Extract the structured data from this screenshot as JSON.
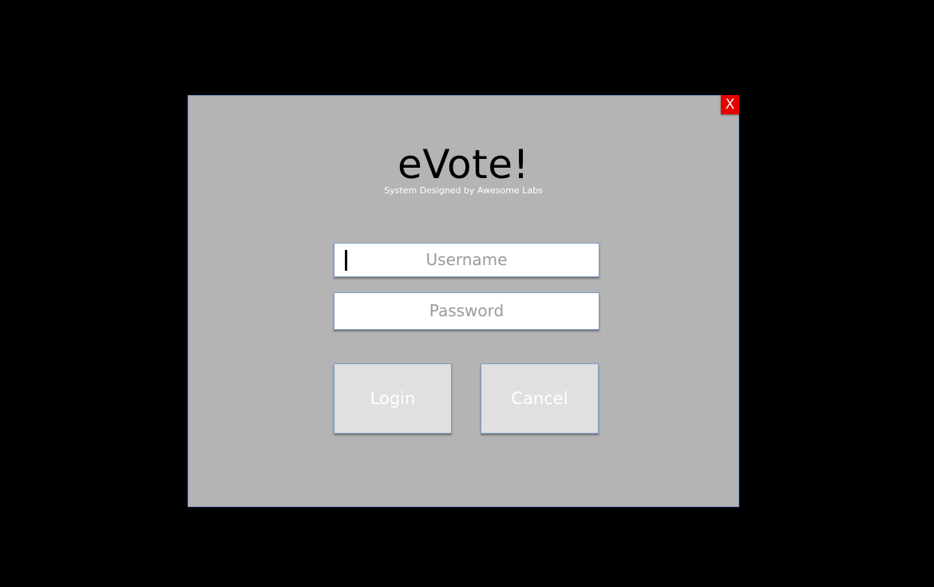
{
  "dialog": {
    "close_label": "X",
    "title": "eVote!",
    "subtitle": "System Designed by Awesome Labs"
  },
  "form": {
    "username_placeholder": "Username",
    "password_placeholder": "Password",
    "login_label": "Login",
    "cancel_label": "Cancel"
  },
  "colors": {
    "background": "#000000",
    "dialog_bg": "#b4b4b4",
    "close_bg": "#e60000",
    "border_accent": "#7b9cc8"
  }
}
